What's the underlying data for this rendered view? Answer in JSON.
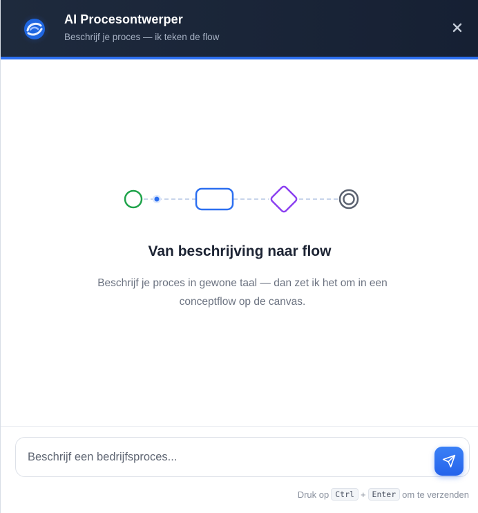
{
  "header": {
    "title": "AI Procesontwerper",
    "subtitle": "Beschrijf je proces — ik teken de flow",
    "logo_icon": "swirl-logo-icon",
    "close_icon": "close-icon",
    "close_symbol": "×"
  },
  "empty_state": {
    "illustration": [
      "start-event-icon",
      "flow-dot-icon",
      "task-icon",
      "gateway-icon",
      "end-event-icon"
    ],
    "title": "Van beschrijving naar flow",
    "description": "Beschrijf je proces in gewone taal — dan zet ik het om in een conceptflow op de canvas."
  },
  "composer": {
    "placeholder": "Beschrijf een bedrijfsproces...",
    "value": "",
    "send_icon": "send-icon"
  },
  "hint": {
    "prefix": "Druk op",
    "key1": "Ctrl",
    "plus": "+",
    "key2": "Enter",
    "suffix": "om te verzenden"
  },
  "colors": {
    "header_bg": "#1e2a3d",
    "accent": "#2c6ff0",
    "start_green": "#1fa34a",
    "task_blue": "#2c6ff0",
    "gateway_purple": "#8b3ff0",
    "end_gray": "#5b6270"
  }
}
